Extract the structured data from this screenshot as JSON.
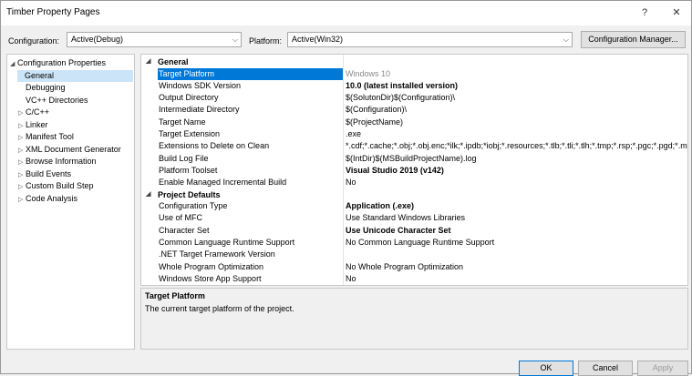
{
  "window": {
    "title": "Timber Property Pages",
    "help_glyph": "?",
    "close_glyph": "✕"
  },
  "config": {
    "configuration_label": "Configuration:",
    "configuration_value": "Active(Debug)",
    "platform_label": "Platform:",
    "platform_value": "Active(Win32)",
    "manager_button": "Configuration Manager..."
  },
  "tree": {
    "items": [
      {
        "label": "Configuration Properties",
        "expander": "◢",
        "indent": 0,
        "selected": false
      },
      {
        "label": "General",
        "expander": "",
        "indent": 1,
        "selected": true
      },
      {
        "label": "Debugging",
        "expander": "",
        "indent": 1,
        "selected": false
      },
      {
        "label": "VC++ Directories",
        "expander": "",
        "indent": 1,
        "selected": false
      },
      {
        "label": "C/C++",
        "expander": "▷",
        "indent": 1,
        "selected": false
      },
      {
        "label": "Linker",
        "expander": "▷",
        "indent": 1,
        "selected": false
      },
      {
        "label": "Manifest Tool",
        "expander": "▷",
        "indent": 1,
        "selected": false
      },
      {
        "label": "XML Document Generator",
        "expander": "▷",
        "indent": 1,
        "selected": false
      },
      {
        "label": "Browse Information",
        "expander": "▷",
        "indent": 1,
        "selected": false
      },
      {
        "label": "Build Events",
        "expander": "▷",
        "indent": 1,
        "selected": false
      },
      {
        "label": "Custom Build Step",
        "expander": "▷",
        "indent": 1,
        "selected": false
      },
      {
        "label": "Code Analysis",
        "expander": "▷",
        "indent": 1,
        "selected": false
      }
    ]
  },
  "grid": {
    "categories": [
      {
        "title": "General",
        "expander": "◢",
        "rows": [
          {
            "name": "Target Platform",
            "value": "Windows 10",
            "bold": false,
            "selected": true
          },
          {
            "name": "Windows SDK Version",
            "value": "10.0 (latest installed version)",
            "bold": true,
            "selected": false
          },
          {
            "name": "Output Directory",
            "value": "$(SolutonDir)$(Configuration)\\",
            "bold": false,
            "selected": false
          },
          {
            "name": "Intermediate Directory",
            "value": "$(Configuration)\\",
            "bold": false,
            "selected": false
          },
          {
            "name": "Target Name",
            "value": "$(ProjectName)",
            "bold": false,
            "selected": false
          },
          {
            "name": "Target Extension",
            "value": ".exe",
            "bold": false,
            "selected": false
          },
          {
            "name": "Extensions to Delete on Clean",
            "value": "*.cdf;*.cache;*.obj;*.obj.enc;*ilk;*.ipdb;*iobj;*.resources;*.tlb;*.tli;*.tlh;*.tmp;*.rsp;*.pgc;*.pgd;*.m",
            "bold": false,
            "selected": false
          },
          {
            "name": "Build Log File",
            "value": "$(IntDir)$(MSBuildProjectName).log",
            "bold": false,
            "selected": false
          },
          {
            "name": "Platform Toolset",
            "value": "Visual Studio 2019 (v142)",
            "bold": true,
            "selected": false
          },
          {
            "name": "Enable Managed Incremental Build",
            "value": "No",
            "bold": false,
            "selected": false
          }
        ]
      },
      {
        "title": "Project Defaults",
        "expander": "◢",
        "rows": [
          {
            "name": "Configuration Type",
            "value": "Application (.exe)",
            "bold": true,
            "selected": false
          },
          {
            "name": "Use of MFC",
            "value": "Use Standard Windows Libraries",
            "bold": false,
            "selected": false
          },
          {
            "name": "Character Set",
            "value": "Use Unicode Character Set",
            "bold": true,
            "selected": false
          },
          {
            "name": "Common Language Runtime Support",
            "value": "No Common Language Runtime Support",
            "bold": false,
            "selected": false
          },
          {
            "name": ".NET Target Framework Version",
            "value": "",
            "bold": false,
            "selected": false
          },
          {
            "name": "Whole Program Optimization",
            "value": "No Whole Program Optimization",
            "bold": false,
            "selected": false
          },
          {
            "name": "Windows Store App Support",
            "value": "No",
            "bold": false,
            "selected": false
          }
        ]
      }
    ]
  },
  "description": {
    "title": "Target Platform",
    "text": "The current target platform of the project."
  },
  "buttons": {
    "ok": "OK",
    "cancel": "Cancel",
    "apply": "Apply"
  },
  "colors": {
    "selection": "#0078d7",
    "tree_selection": "#cce4f7"
  }
}
